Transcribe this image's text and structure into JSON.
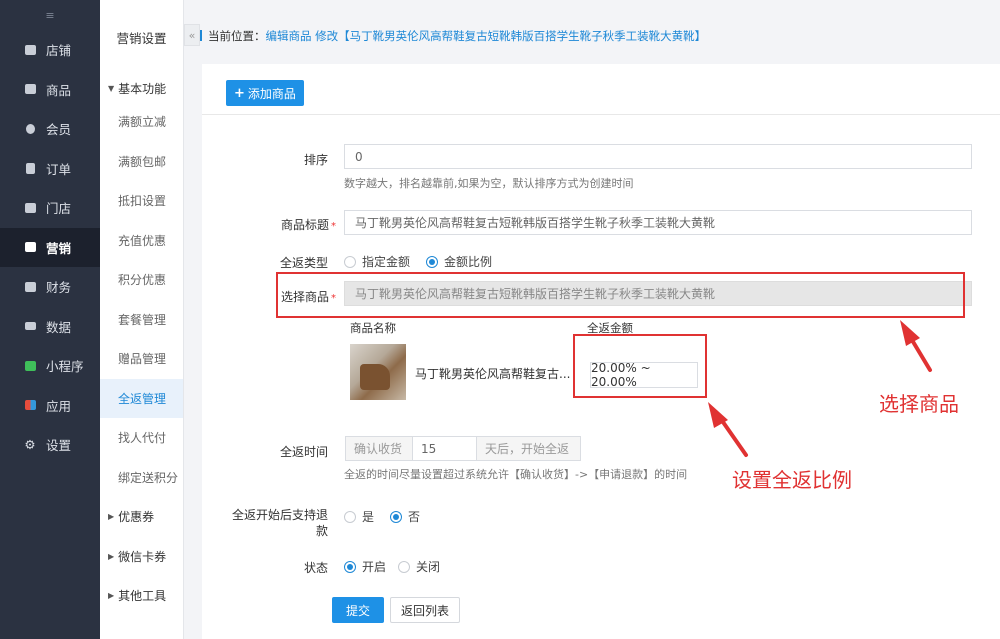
{
  "nav": {
    "items": [
      {
        "label": "店铺",
        "icon": "store-icon"
      },
      {
        "label": "商品",
        "icon": "goods-icon"
      },
      {
        "label": "会员",
        "icon": "member-icon"
      },
      {
        "label": "订单",
        "icon": "order-icon"
      },
      {
        "label": "门店",
        "icon": "shop-icon"
      },
      {
        "label": "营销",
        "icon": "gift-icon",
        "active": true
      },
      {
        "label": "财务",
        "icon": "finance-icon"
      },
      {
        "label": "数据",
        "icon": "chart-icon"
      },
      {
        "label": "小程序",
        "icon": "miniprogram-icon"
      },
      {
        "label": "应用",
        "icon": "apps-icon"
      },
      {
        "label": "设置",
        "icon": "gear-icon"
      }
    ]
  },
  "submenu": {
    "title": "营销设置",
    "collapse": "«",
    "group_basic": "基本功能",
    "items": [
      "满额立减",
      "满额包邮",
      "抵扣设置",
      "充值优惠",
      "积分优惠",
      "套餐管理",
      "赠品管理",
      "全返管理",
      "找人代付",
      "绑定送积分"
    ],
    "active": "全返管理",
    "group_coupon": "优惠券",
    "group_wxcard": "微信卡券",
    "group_tools": "其他工具"
  },
  "breadcrumb": {
    "prefix": "当前位置：",
    "path": "编辑商品 修改【马丁靴男英伦风高帮鞋复古短靴韩版百搭学生靴子秋季工装靴大黄靴】"
  },
  "toolbar": {
    "add_label": "添加商品",
    "add_icon": "+"
  },
  "form": {
    "sort_label": "排序",
    "sort_value": "0",
    "sort_hint": "数字越大，排名越靠前,如果为空，默认排序方式为创建时间",
    "title_label": "商品标题",
    "title_value": "马丁靴男英伦风高帮鞋复古短靴韩版百搭学生靴子秋季工装靴大黄靴",
    "type_label": "全返类型",
    "type_option_fixed": "指定金额",
    "type_option_ratio": "金额比例",
    "select_label": "选择商品",
    "select_value": "马丁靴男英伦风高帮鞋复古短靴韩版百搭学生靴子秋季工装靴大黄靴",
    "col_name": "商品名称",
    "col_amount": "全返金额",
    "product_name": "马丁靴男英伦风高帮鞋复古...",
    "ratio_value": "20.00% ~ 20.00%",
    "time_label": "全返时间",
    "time_prefix": "确认收货",
    "time_value": "15",
    "time_suffix": "天后，开始全返",
    "time_hint": "全返的时间尽量设置超过系统允许【确认收货】->【申请退款】的时间",
    "refund_label_1": "全返开始后支持退",
    "refund_label_2": "款",
    "refund_yes": "是",
    "refund_no": "否",
    "status_label": "状态",
    "status_on": "开启",
    "status_off": "关闭",
    "submit_label": "提交",
    "back_label": "返回列表"
  },
  "annotations": {
    "select_goods": "选择商品",
    "set_ratio": "设置全返比例",
    "color": "#e03232"
  }
}
